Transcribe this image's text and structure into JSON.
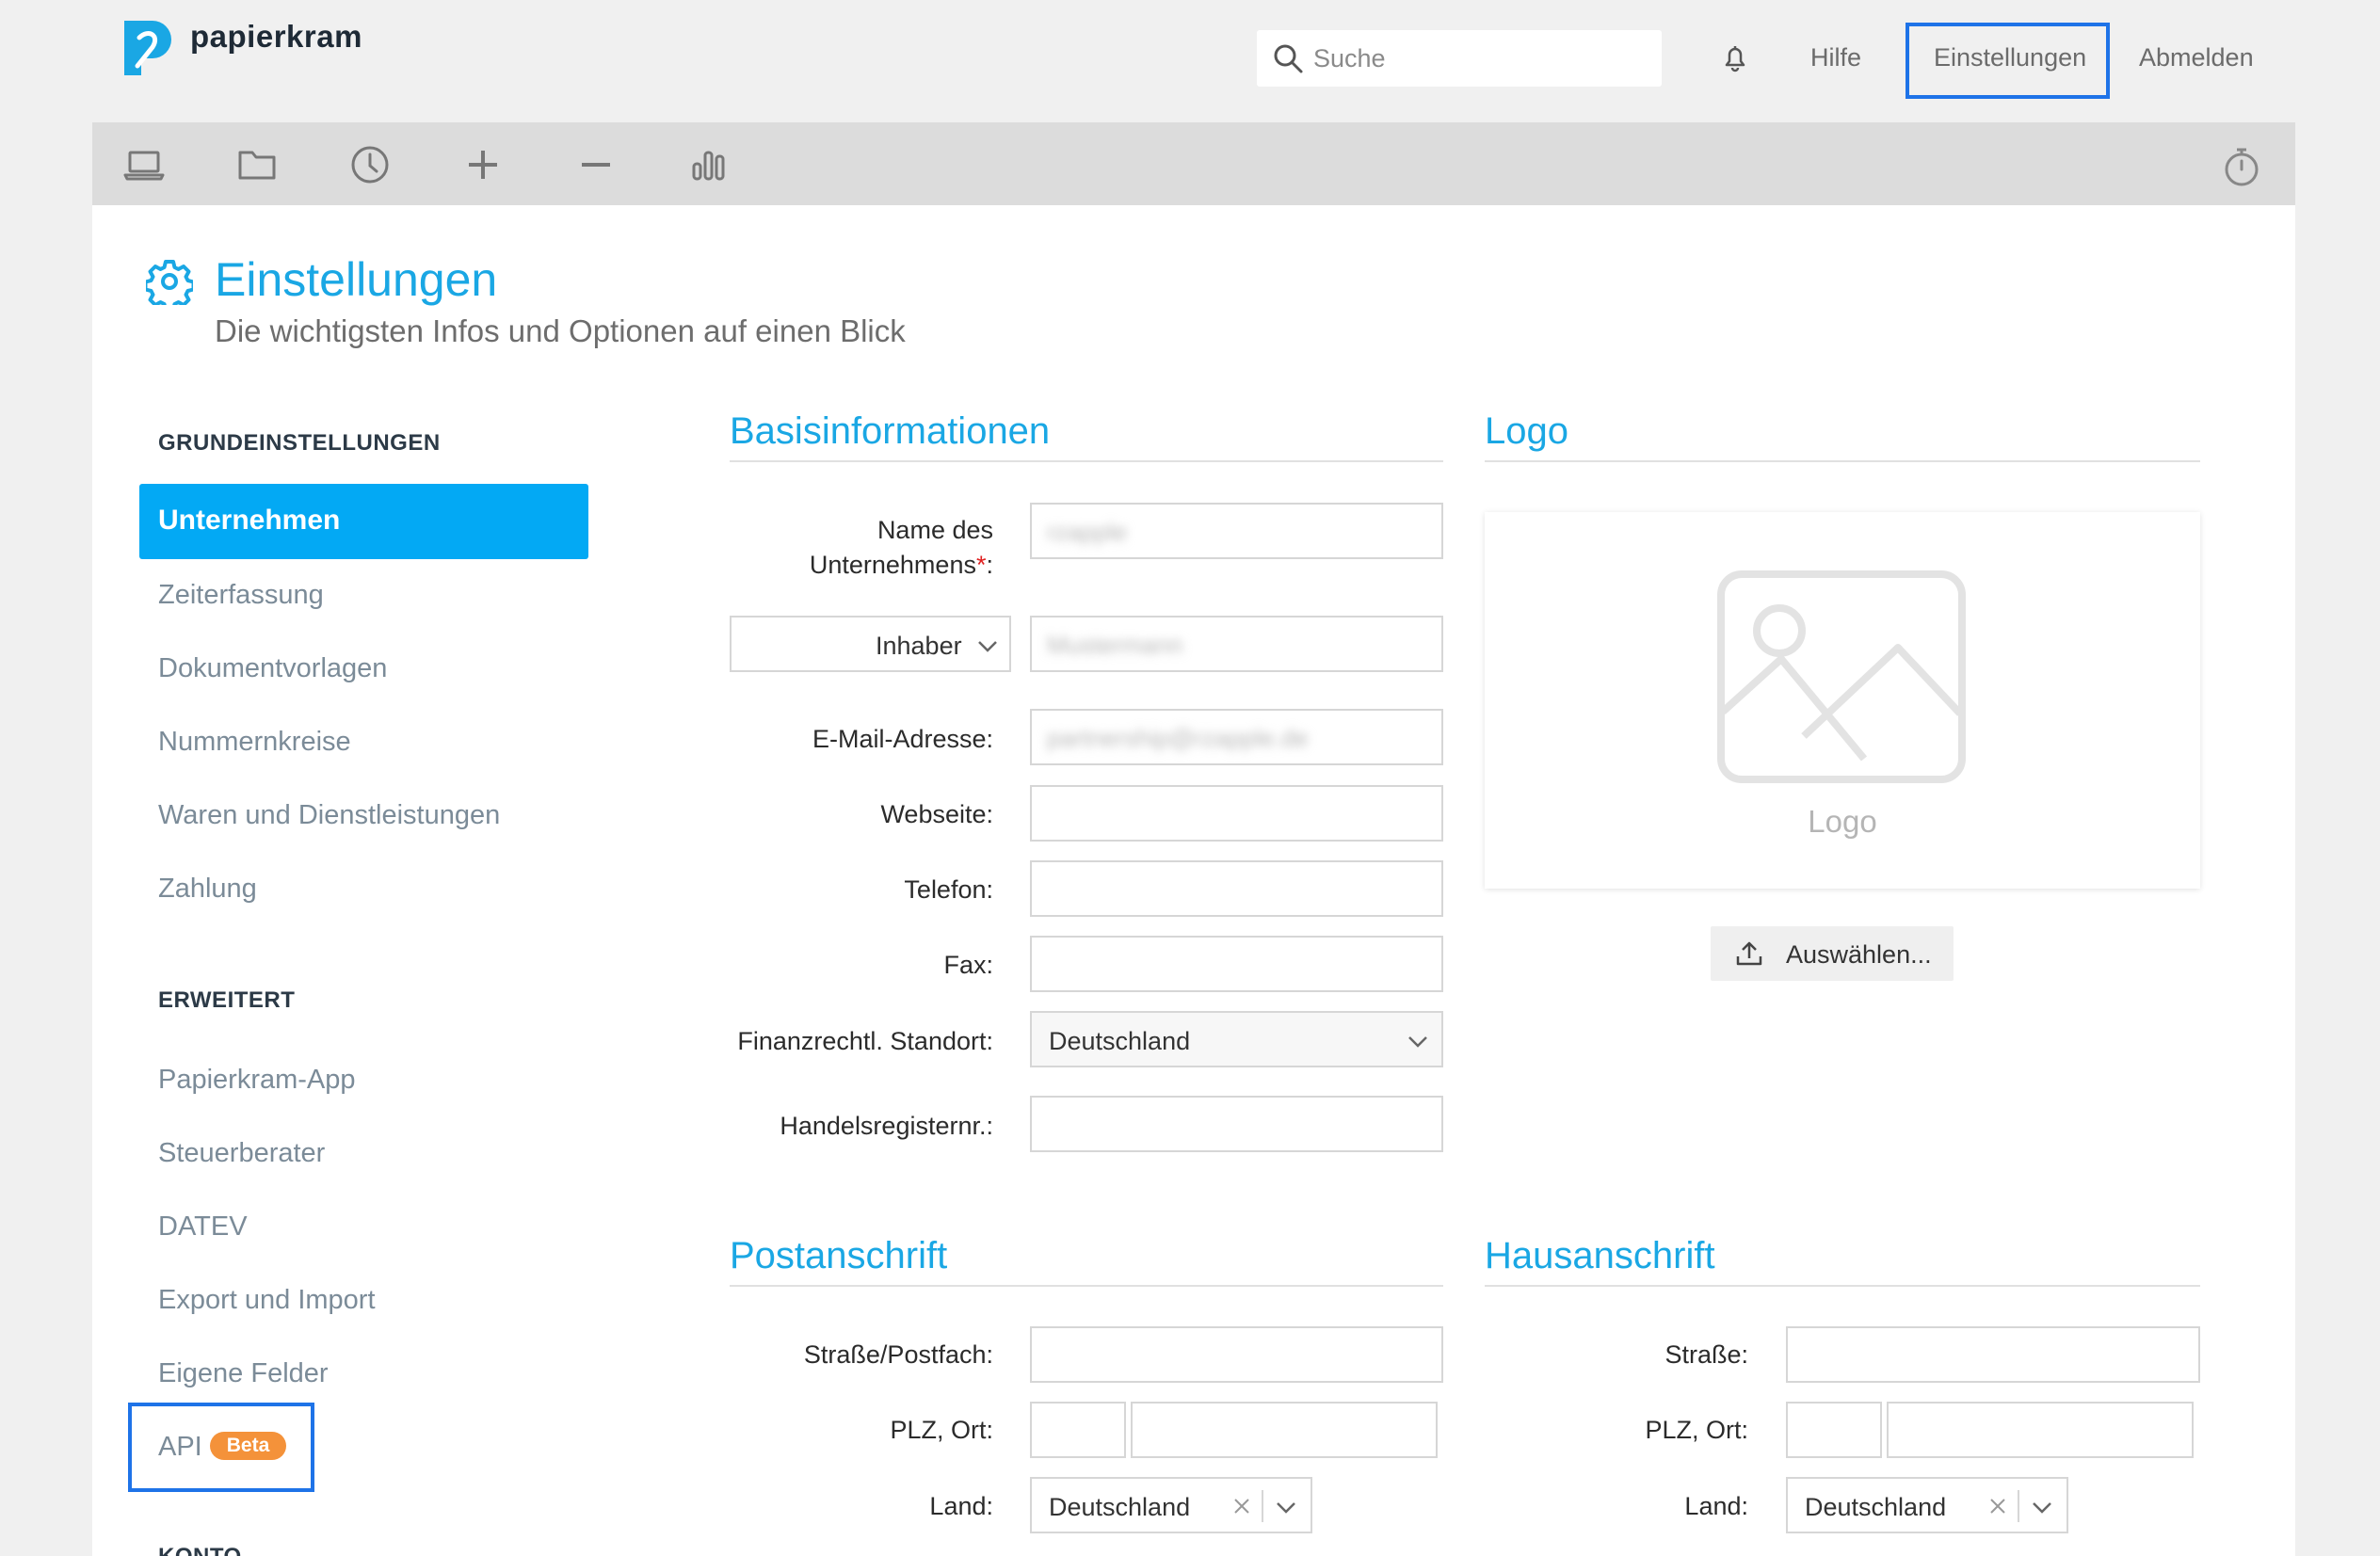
{
  "header": {
    "brand": "papierkram",
    "search_placeholder": "Suche",
    "links": {
      "help": "Hilfe",
      "settings": "Einstellungen",
      "logout": "Abmelden"
    }
  },
  "toolbar": {
    "icons": [
      "laptop-icon",
      "folder-icon",
      "clock-icon",
      "plus-icon",
      "minus-icon",
      "bar-chart-icon",
      "stopwatch-icon"
    ]
  },
  "page": {
    "title": "Einstellungen",
    "subtitle": "Die wichtigsten Infos und Optionen auf einen Blick"
  },
  "sidebar": {
    "section1": "GRUNDEINSTELLUNGEN",
    "items1": [
      "Unternehmen",
      "Zeiterfassung",
      "Dokumentvorlagen",
      "Nummernkreise",
      "Waren und Dienstleistungen",
      "Zahlung"
    ],
    "section2": "ERWEITERT",
    "items2": [
      "Papierkram-App",
      "Steuerberater",
      "DATEV",
      "Export und Import",
      "Eigene Felder",
      "API"
    ],
    "api_badge": "Beta",
    "section3": "KONTO"
  },
  "basis": {
    "title": "Basisinformationen",
    "name_label_1": "Name des",
    "name_label_2": "Unternehmens",
    "name_required": "*",
    "name_suffix": ":",
    "name_value": "rzapple",
    "owner_select": "Inhaber",
    "owner_value": "Mustermann",
    "email_label": "E-Mail-Adresse:",
    "email_value": "partnership@rzapple.de",
    "website_label": "Webseite:",
    "phone_label": "Telefon:",
    "fax_label": "Fax:",
    "location_label": "Finanzrechtl. Standort:",
    "location_value": "Deutschland",
    "register_label": "Handelsregisternr.:"
  },
  "logo": {
    "title": "Logo",
    "placeholder_label": "Logo",
    "upload_button": "Auswählen..."
  },
  "postal": {
    "title": "Postanschrift",
    "street_label": "Straße/Postfach:",
    "zip_label": "PLZ, Ort:",
    "country_label": "Land:",
    "country_value": "Deutschland"
  },
  "home": {
    "title": "Hausanschrift",
    "street_label": "Straße:",
    "zip_label": "PLZ, Ort:",
    "country_label": "Land:",
    "country_value": "Deutschland"
  },
  "colors": {
    "accent": "#1aa7e4",
    "active": "#03a9f4",
    "highlight": "#1e73e8",
    "beta": "#f4923a"
  }
}
